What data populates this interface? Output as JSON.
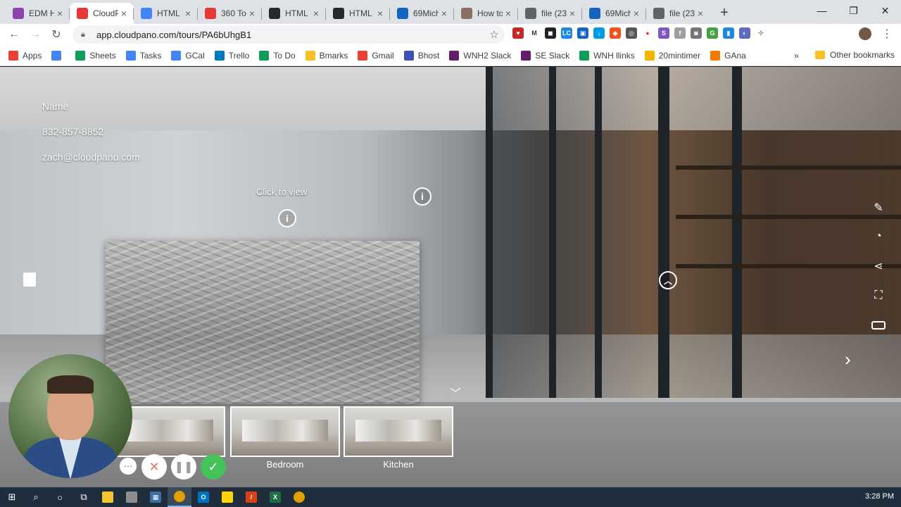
{
  "browser": {
    "tabs": [
      {
        "title": "EDM Hi",
        "favicon": "edm-favicon",
        "color": "#8e44ad",
        "active": false
      },
      {
        "title": "CloudP",
        "favicon": "cloudpano-favicon",
        "color": "#e53935",
        "active": true
      },
      {
        "title": "HTML S",
        "favicon": "docs-favicon",
        "color": "#4285f4",
        "active": false
      },
      {
        "title": "360 To",
        "favicon": "360-favicon",
        "color": "#e53935",
        "active": false
      },
      {
        "title": "HTML E",
        "favicon": "github-favicon",
        "color": "#24292e",
        "active": false
      },
      {
        "title": "HTML E",
        "favicon": "github-favicon",
        "color": "#24292e",
        "active": false
      },
      {
        "title": "69Mich",
        "favicon": "heart-favicon",
        "color": "#1565c0",
        "active": false
      },
      {
        "title": "How to",
        "favicon": "person-favicon",
        "color": "#8d6e63",
        "active": false
      },
      {
        "title": "file (23",
        "favicon": "globe-favicon",
        "color": "#5f6368",
        "active": false
      },
      {
        "title": "69Mich",
        "favicon": "heart-favicon",
        "color": "#1565c0",
        "active": false
      },
      {
        "title": "file (23",
        "favicon": "globe-favicon",
        "color": "#5f6368",
        "active": false
      }
    ],
    "new_tab": "+",
    "window_controls": {
      "minimize": "—",
      "maximize": "❐",
      "close": "✕"
    },
    "url": "app.cloudpano.com/tours/PA6bUhgB1",
    "bookmarks": [
      {
        "label": "Apps",
        "icon": "apps-grid-icon",
        "color": "#ea4335"
      },
      {
        "label": "",
        "icon": "docs-icon",
        "color": "#4285f4"
      },
      {
        "label": "Sheets",
        "icon": "plus-icon",
        "color": "#0f9d58"
      },
      {
        "label": "Tasks",
        "icon": "google-icon",
        "color": "#4285f4"
      },
      {
        "label": "GCal",
        "icon": "calendar-icon",
        "color": "#4285f4"
      },
      {
        "label": "Trello",
        "icon": "trello-icon",
        "color": "#0079bf"
      },
      {
        "label": "To Do",
        "icon": "plus-icon",
        "color": "#0f9d58"
      },
      {
        "label": "Bmarks",
        "icon": "folder-icon",
        "color": "#f6c026"
      },
      {
        "label": "Gmail",
        "icon": "gmail-icon",
        "color": "#ea4335"
      },
      {
        "label": "Bhost",
        "icon": "grid-icon",
        "color": "#3f51b5"
      },
      {
        "label": "WNH2 Slack",
        "icon": "slack-icon",
        "color": "#611f69"
      },
      {
        "label": "SE Slack",
        "icon": "slack-icon",
        "color": "#611f69"
      },
      {
        "label": "WNH llinks",
        "icon": "plus-icon",
        "color": "#0f9d58"
      },
      {
        "label": "20mintimer",
        "icon": "timer-icon",
        "color": "#f4b400"
      },
      {
        "label": "GAna",
        "icon": "analytics-icon",
        "color": "#f57c00"
      }
    ],
    "bookmarks_more": "»",
    "other_bookmarks": "Other bookmarks"
  },
  "tour": {
    "contact": {
      "name": "Name",
      "phone": "832-857-8852",
      "email": "zach@cloudpano.com"
    },
    "click_to_view": "Click to view",
    "thumbnails": [
      {
        "label": "",
        "name": "living-room"
      },
      {
        "label": "Bedroom",
        "name": "bedroom"
      },
      {
        "label": "Kitchen",
        "name": "kitchen"
      }
    ],
    "side_tools": [
      "edit-icon",
      "speed-icon",
      "share-icon",
      "fullscreen-icon",
      "vr-icon"
    ]
  },
  "taskbar": {
    "time": "3:28 PM"
  }
}
